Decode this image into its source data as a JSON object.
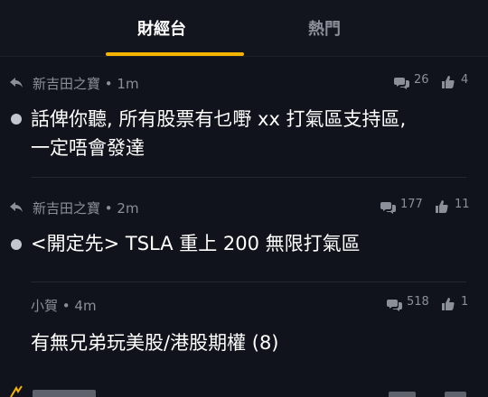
{
  "tabs": [
    {
      "label": "財經台",
      "active": true
    },
    {
      "label": "熱門",
      "active": false
    }
  ],
  "accent_color": "#f4b400",
  "posts": [
    {
      "author": "新吉田之寶",
      "time": "• 1m",
      "comments": "26",
      "likes": "4",
      "title_line1": "話俾你聽, 所有股票有乜嘢 xx 打氣區支持區,",
      "title_line2": "一定唔會發達",
      "has_reply_icon": true,
      "has_bullet": true
    },
    {
      "author": "新吉田之寶",
      "time": "• 2m",
      "comments": "177",
      "likes": "11",
      "title_line1": "<開定先> TSLA 重上 200 無限打氣區",
      "has_reply_icon": true,
      "has_bullet": true
    },
    {
      "author": "小賀",
      "time": "• 4m",
      "comments": "518",
      "likes": "1",
      "title_line1": "有無兄弟玩美股/港股期權 (8)",
      "has_reply_icon": false,
      "has_bullet": false
    }
  ],
  "icons": {
    "reply": "reply-arrow-icon",
    "comments": "speech-bubbles-icon",
    "likes": "thumbs-up-icon"
  }
}
